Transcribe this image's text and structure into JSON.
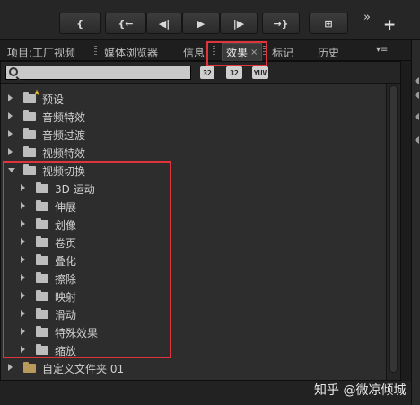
{
  "transport": {
    "buttons": [
      {
        "name": "mark-in-button",
        "label": "{"
      },
      {
        "name": "go-to-in-button",
        "label": "{←"
      },
      {
        "name": "step-back-button",
        "label": "◀|"
      },
      {
        "name": "play-button",
        "label": "▶"
      },
      {
        "name": "step-forward-button",
        "label": "|▶"
      },
      {
        "name": "go-to-out-button",
        "label": "→}"
      },
      {
        "name": "insert-button",
        "label": "⊞"
      }
    ],
    "more_label": "»",
    "add_label": "+"
  },
  "tabs": {
    "project": "项目:工厂视频",
    "media_browser": "媒体浏览器",
    "info": "信息",
    "effects": "效果",
    "effects_close": "×",
    "markers": "标记",
    "history": "历史",
    "menu": "▾≡"
  },
  "search": {
    "placeholder": "",
    "tag_buttons": [
      "32",
      "32",
      "YUV"
    ]
  },
  "tree": {
    "items": [
      {
        "label": "预设",
        "expanded": false,
        "level": 0,
        "icon": "preset-folder-icon"
      },
      {
        "label": "音频特效",
        "expanded": false,
        "level": 0,
        "icon": "folder-icon"
      },
      {
        "label": "音频过渡",
        "expanded": false,
        "level": 0,
        "icon": "folder-icon"
      },
      {
        "label": "视频特效",
        "expanded": false,
        "level": 0,
        "icon": "folder-icon"
      },
      {
        "label": "视频切换",
        "expanded": true,
        "level": 0,
        "icon": "folder-icon"
      },
      {
        "label": "3D 运动",
        "expanded": false,
        "level": 1,
        "icon": "folder-icon"
      },
      {
        "label": "伸展",
        "expanded": false,
        "level": 1,
        "icon": "folder-icon"
      },
      {
        "label": "划像",
        "expanded": false,
        "level": 1,
        "icon": "folder-icon"
      },
      {
        "label": "卷页",
        "expanded": false,
        "level": 1,
        "icon": "folder-icon"
      },
      {
        "label": "叠化",
        "expanded": false,
        "level": 1,
        "icon": "folder-icon"
      },
      {
        "label": "擦除",
        "expanded": false,
        "level": 1,
        "icon": "folder-icon"
      },
      {
        "label": "映射",
        "expanded": false,
        "level": 1,
        "icon": "folder-icon"
      },
      {
        "label": "滑动",
        "expanded": false,
        "level": 1,
        "icon": "folder-icon"
      },
      {
        "label": "特殊效果",
        "expanded": false,
        "level": 1,
        "icon": "folder-icon"
      },
      {
        "label": "缩放",
        "expanded": false,
        "level": 1,
        "icon": "folder-icon"
      },
      {
        "label": "自定义文件夹 01",
        "expanded": false,
        "level": 0,
        "icon": "custom-folder-icon"
      }
    ]
  },
  "watermark": "知乎 @微凉倾城",
  "colors": {
    "highlight": "#e0343c",
    "panel_bg": "#2d2d2d",
    "custom_folder": "#b89a5a"
  }
}
